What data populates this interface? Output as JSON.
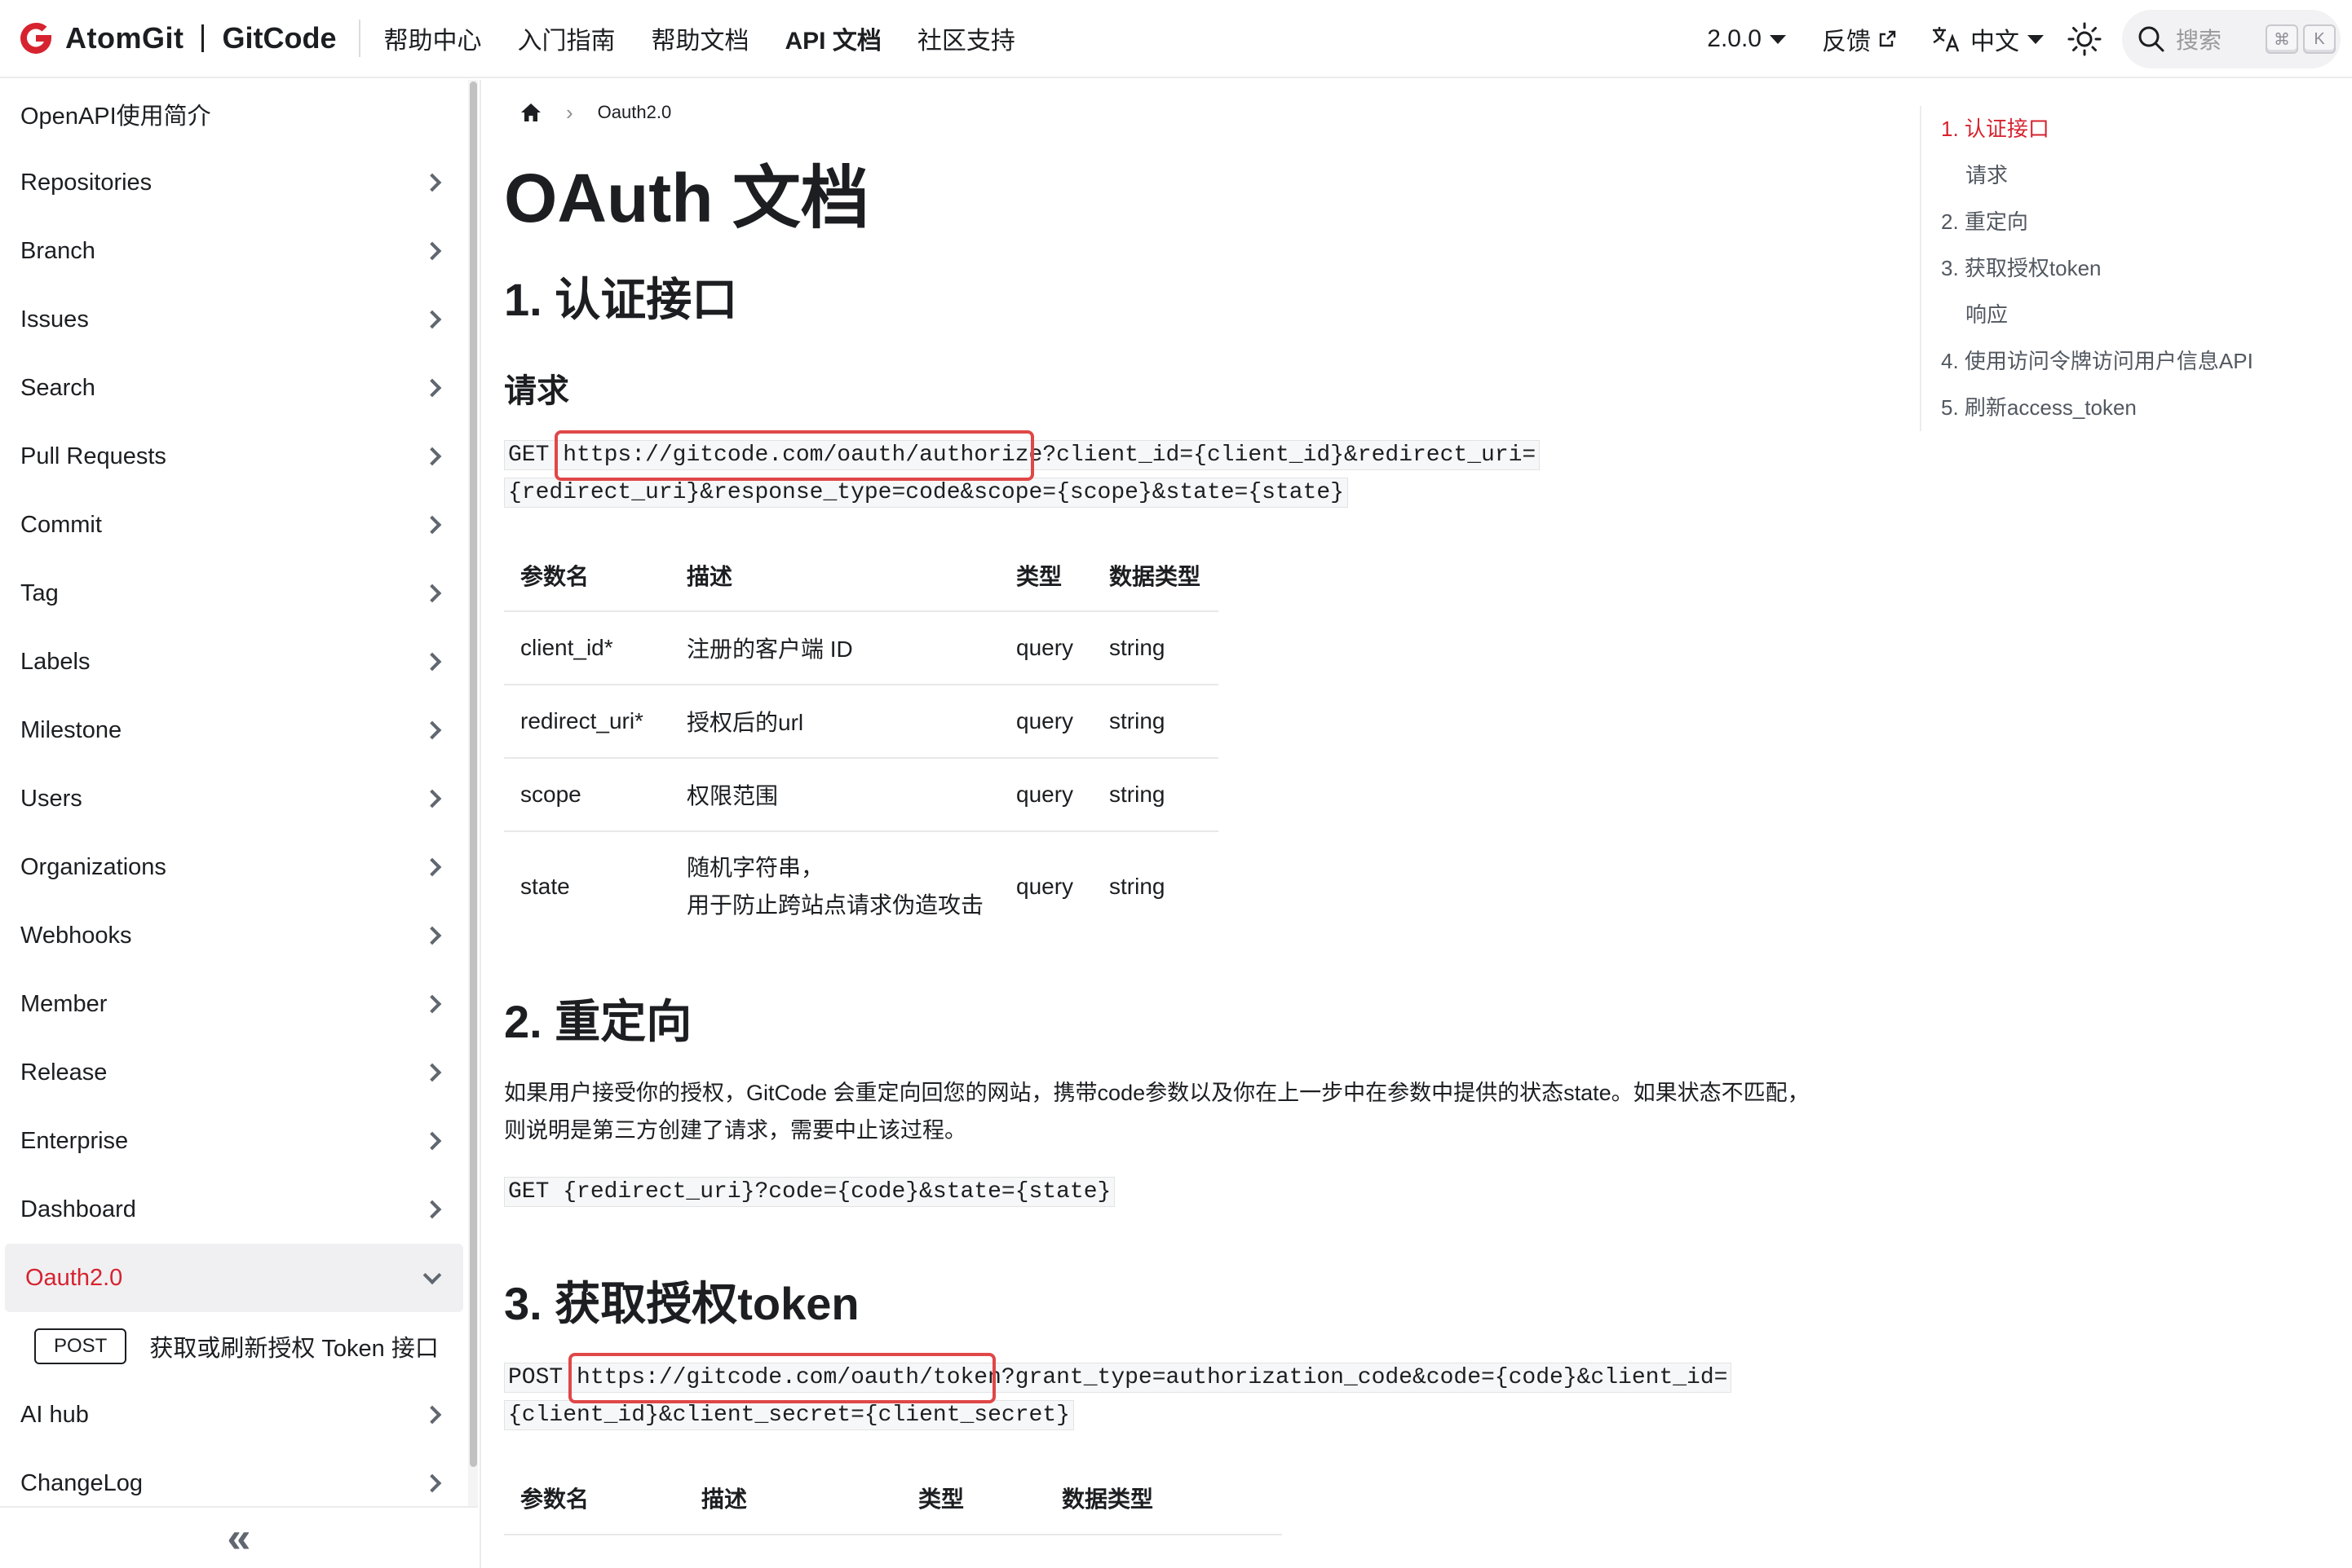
{
  "brand": {
    "name_a": "AtomGit",
    "name_b": "GitCode",
    "accent": "#d6232f"
  },
  "nav": {
    "links": [
      "帮助中心",
      "入门指南",
      "帮助文档",
      "API 文档",
      "社区支持"
    ],
    "version": "2.0.0",
    "feedback": "反馈",
    "language": "中文",
    "search_placeholder": "搜索",
    "shortcut_keys": [
      "⌘",
      "K"
    ]
  },
  "sidebar": {
    "intro": "OpenAPI使用简介",
    "items": [
      "Repositories",
      "Branch",
      "Issues",
      "Search",
      "Pull Requests",
      "Commit",
      "Tag",
      "Labels",
      "Milestone",
      "Users",
      "Organizations",
      "Webhooks",
      "Member",
      "Release",
      "Enterprise",
      "Dashboard"
    ],
    "active": "Oauth2.0",
    "sub": {
      "method": "POST",
      "label": "获取或刷新授权 Token 接口"
    },
    "after": [
      "AI hub",
      "ChangeLog"
    ],
    "collapse_icon": "«"
  },
  "breadcrumb": {
    "current": "Oauth2.0"
  },
  "doc": {
    "title": "OAuth 文档",
    "s1_title": "1. 认证接口",
    "s1_req": "请求",
    "s1_code_method": "GET ",
    "s1_code_url": "https://gitcode.com/oauth/authorize",
    "s1_code_rest1": "?client_id={client_id}&redirect_uri=",
    "s1_code_rest2": "{redirect_uri}&response_type=code&scope={scope}&state={state}",
    "table1": {
      "headers": [
        "参数名",
        "描述",
        "类型",
        "数据类型"
      ],
      "rows": [
        [
          "client_id*",
          "注册的客户端 ID",
          "query",
          "string"
        ],
        [
          "redirect_uri*",
          "授权后的url",
          "query",
          "string"
        ],
        [
          "scope",
          "权限范围",
          "query",
          "string"
        ],
        [
          "state",
          "随机字符串，\n用于防止跨站点请求伪造攻击",
          "query",
          "string"
        ]
      ]
    },
    "s2_title": "2. 重定向",
    "s2_p1": "如果用户接受你的授权，GitCode 会重定向回您的网站，携带code参数以及你在上一步中在参数中提供的状态state。如果状态不匹配，",
    "s2_p2": "则说明是第三方创建了请求，需要中止该过程。",
    "s2_code": "GET {redirect_uri}?code={code}&state={state}",
    "s3_title": "3. 获取授权token",
    "s3_code_method": "POST ",
    "s3_code_url": "https://gitcode.com/oauth/token",
    "s3_code_rest1": "?grant_type=authorization_code&code={code}&client_id=",
    "s3_code_rest2": "{client_id}&client_secret={client_secret}",
    "table2_headers": [
      "参数名",
      "描述",
      "类型",
      "数据类型"
    ]
  },
  "toc": [
    {
      "label": "1. 认证接口",
      "active": true,
      "sub": false
    },
    {
      "label": "请求",
      "active": false,
      "sub": true
    },
    {
      "label": "2. 重定向",
      "active": false,
      "sub": false
    },
    {
      "label": "3. 获取授权token",
      "active": false,
      "sub": false
    },
    {
      "label": "响应",
      "active": false,
      "sub": true
    },
    {
      "label": "4. 使用访问令牌访问用户信息API",
      "active": false,
      "sub": false
    },
    {
      "label": "5. 刷新access_token",
      "active": false,
      "sub": false
    }
  ]
}
